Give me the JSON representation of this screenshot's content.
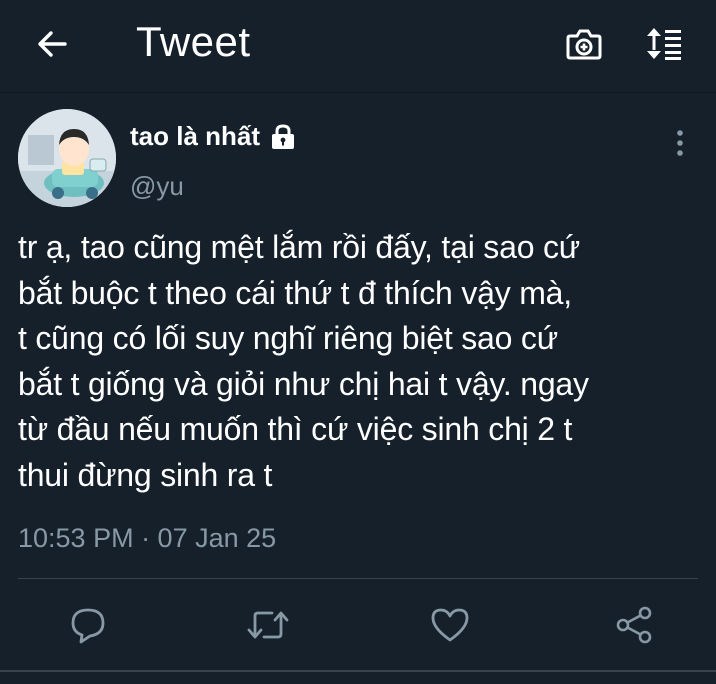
{
  "header": {
    "title": "Tweet",
    "back_icon": "arrow-left-icon",
    "camera_icon": "camera-icon",
    "sort_icon": "sort-icon"
  },
  "tweet": {
    "display_name": "tao là nhất",
    "handle": "@yu",
    "protected_icon": "lock-icon",
    "text": "tr ạ, tao cũng mệt lắm rồi đấy, tại sao cứ\nbắt buộc t theo cái thứ t đ thích vậy mà,\nt cũng có lối suy nghĩ riêng biệt sao cứ\nbắt t giống và giỏi như chị hai t vậy. ngay\ntừ đầu nếu muốn thì cứ việc sinh chị 2 t\nthui đừng sinh ra t",
    "timestamp": "10:53 PM · 07 Jan 25"
  },
  "actions": [
    "reply-icon",
    "retweet-icon",
    "like-icon",
    "share-icon"
  ],
  "colors": {
    "background": "#15202b",
    "secondary_text": "#8899a6",
    "divider": "#38444d",
    "icon": "#8899a6"
  }
}
